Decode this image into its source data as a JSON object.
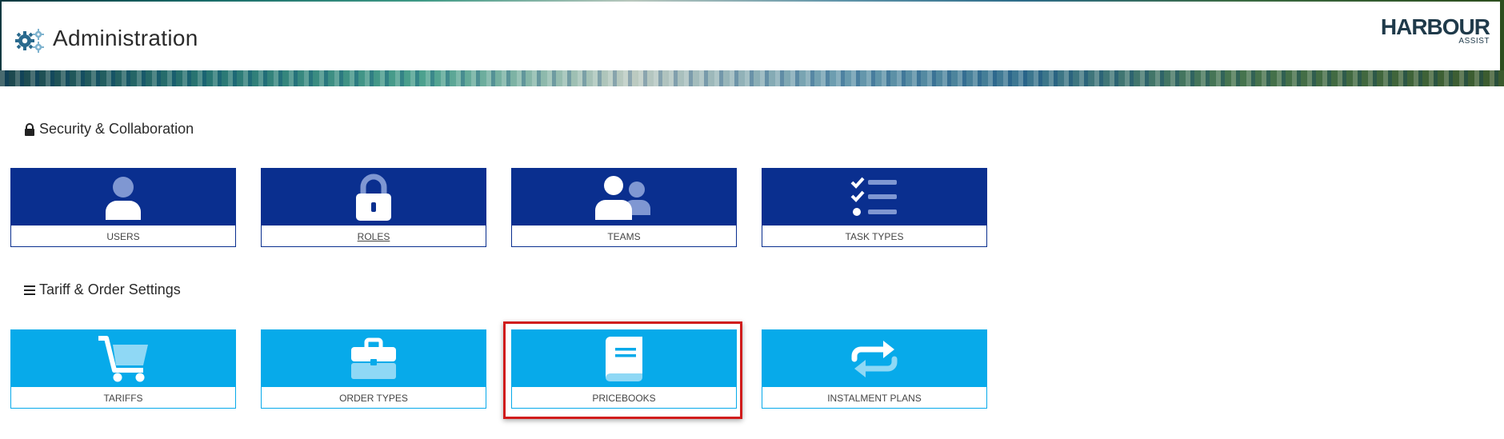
{
  "header": {
    "title": "Administration",
    "icon": "gears-icon",
    "logo": {
      "main": "HARBOUR",
      "sub": "ASSIST"
    }
  },
  "sections": [
    {
      "title": "Security & Collaboration",
      "icon": "lock-icon",
      "tiles": [
        {
          "label": "USERS",
          "icon": "user-icon"
        },
        {
          "label": "ROLES",
          "icon": "lock-icon"
        },
        {
          "label": "TEAMS",
          "icon": "team-icon"
        },
        {
          "label": "TASK TYPES",
          "icon": "checklist-icon"
        }
      ]
    },
    {
      "title": "Tariff & Order Settings",
      "icon": "list-icon",
      "tiles": [
        {
          "label": "TARIFFS",
          "icon": "cart-icon"
        },
        {
          "label": "ORDER TYPES",
          "icon": "briefcase-icon"
        },
        {
          "label": "PRICEBOOKS",
          "icon": "book-icon"
        },
        {
          "label": "INSTALMENT PLANS",
          "icon": "repeat-icon"
        }
      ]
    }
  ],
  "colors": {
    "security_tile": "#0a2f8f",
    "tariff_tile": "#07aaea",
    "highlight": "#d01c1c"
  }
}
